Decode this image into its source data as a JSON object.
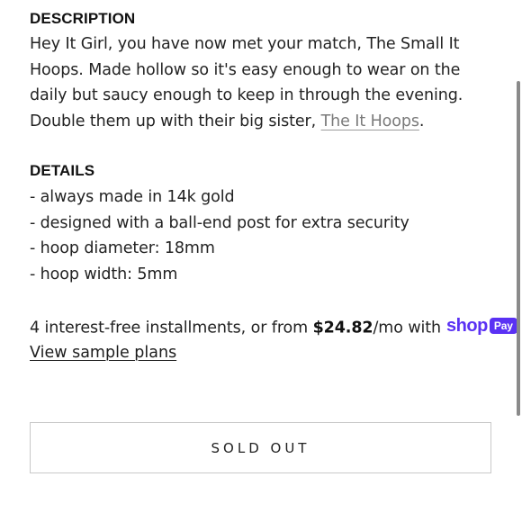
{
  "description": {
    "heading": "DESCRIPTION",
    "text_before_link": "Hey It Girl, you have now met your match, The Small It Hoops. Made hollow so it's easy enough to wear on the daily but saucy enough to keep in through the evening. Double them up with their big sister, ",
    "link_text": "The It Hoops",
    "text_after_link": "."
  },
  "details": {
    "heading": "DETAILS",
    "items": [
      "- always made in 14k gold",
      "- designed with a ball-end post for extra security",
      "- hoop diameter: 18mm",
      "- hoop width: 5mm"
    ]
  },
  "shop_pay": {
    "prefix": "4 interest-free installments, or from ",
    "price": "$24.82",
    "suffix": "/mo with",
    "logo_word": "shop",
    "logo_badge": "Pay",
    "view_plans": "View sample plans",
    "brand_color": "#5a31f4"
  },
  "cta": {
    "label": "SOLD OUT"
  },
  "icons": {
    "scrollbar": "scrollbar-thumb"
  }
}
